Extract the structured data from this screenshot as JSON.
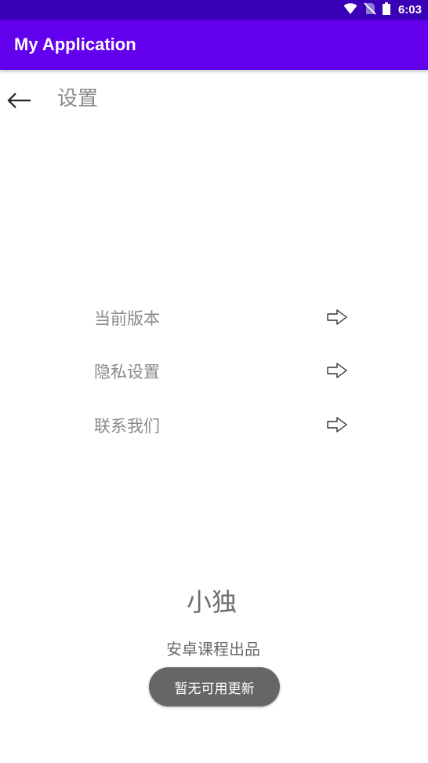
{
  "status_bar": {
    "time": "6:03",
    "icons": [
      "wifi-icon",
      "no-sim-icon",
      "battery-icon"
    ],
    "color": "#3a00b8"
  },
  "app_bar": {
    "title": "My Application",
    "color": "#6200ee"
  },
  "toolbar": {
    "back_icon": "arrow-left-icon",
    "title": "设置"
  },
  "settings": {
    "items": [
      {
        "label": "当前版本",
        "icon": "arrow-right-outline-icon"
      },
      {
        "label": "隐私设置",
        "icon": "arrow-right-outline-icon"
      },
      {
        "label": "联系我们",
        "icon": "arrow-right-outline-icon"
      }
    ]
  },
  "footer": {
    "brand": "小独",
    "subtitle": "安卓课程出品"
  },
  "toast": {
    "message": "暂无可用更新"
  }
}
